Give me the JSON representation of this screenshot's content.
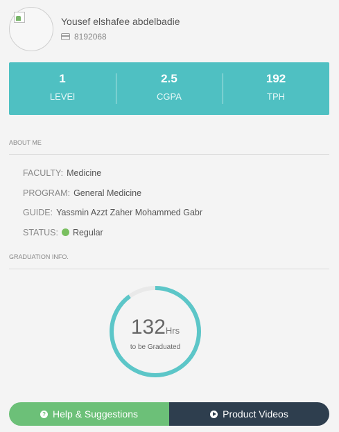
{
  "profile": {
    "name": "Yousef elshafee abdelbadie",
    "id": "8192068",
    "id_icon": "id-card-icon",
    "avatar_icon": "broken-image-icon"
  },
  "stats": [
    {
      "value": "1",
      "label": "LEVEl"
    },
    {
      "value": "2.5",
      "label": "CGPA"
    },
    {
      "value": "192",
      "label": "TPH"
    }
  ],
  "about": {
    "title": "ABOUT ME",
    "faculty": {
      "key": "FACULTY:",
      "value": "Medicine"
    },
    "program": {
      "key": "PROGRAM:",
      "value": "General Medicine"
    },
    "guide": {
      "key": "GUIDE:",
      "value": "Yassmin Azzt Zaher Mohammed Gabr"
    },
    "status": {
      "key": "STATUS:",
      "value": "Regular",
      "color": "#79bf5f"
    }
  },
  "graduation": {
    "title": "GRADUATION INFO.",
    "hours": "132",
    "unit": "Hrs",
    "subtitle": "to be Graduated",
    "progress": 0.9,
    "color": "#5cc6c8",
    "track_color": "#e9e9e9"
  },
  "buttons": {
    "help_label": "Help & Suggestions",
    "help_icon": "question-circle-icon",
    "videos_label": "Product Videos",
    "videos_icon": "play-circle-icon"
  },
  "colors": {
    "accent": "#4fc0c2",
    "help": "#6cc078",
    "dark": "#2e3e4e"
  }
}
